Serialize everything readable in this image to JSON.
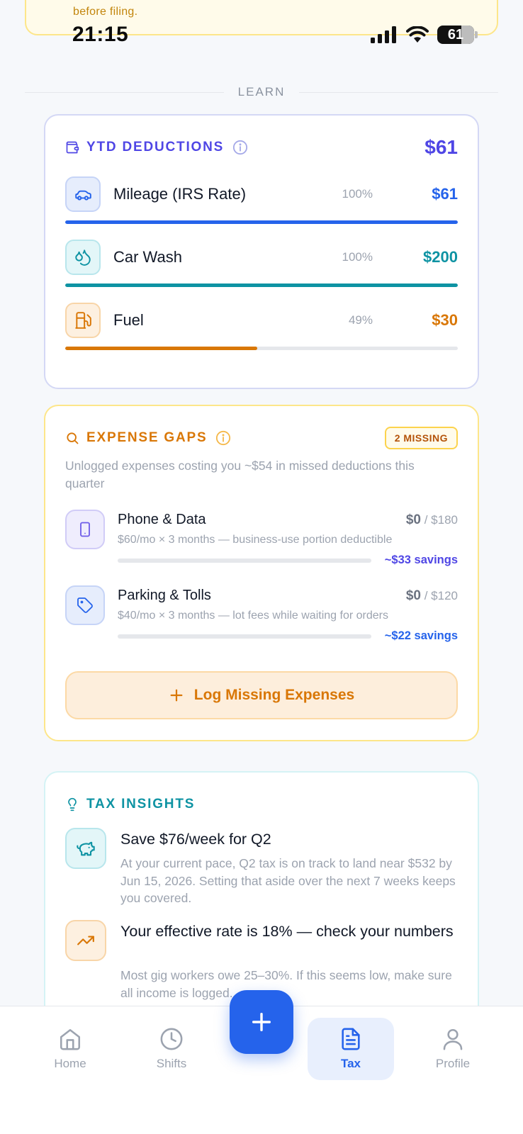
{
  "top_banner": {
    "text": "before filing."
  },
  "status_bar": {
    "time": "21:15",
    "battery": "61"
  },
  "section": {
    "label": "LEARN"
  },
  "ytd": {
    "title": "YTD DEDUCTIONS",
    "total": "$61",
    "items": [
      {
        "name": "Mileage (IRS Rate)",
        "percent": "100%",
        "amount": "$61",
        "fill": 1.0,
        "color": "#2563eb",
        "icon": "car-icon"
      },
      {
        "name": "Car Wash",
        "percent": "100%",
        "amount": "$200",
        "fill": 1.0,
        "color": "#0e93a3",
        "icon": "droplets-icon"
      },
      {
        "name": "Fuel",
        "percent": "49%",
        "amount": "$30",
        "fill": 0.49,
        "color": "#d97706",
        "icon": "fuel-icon"
      }
    ]
  },
  "gaps": {
    "title": "EXPENSE GAPS",
    "badge": "2 MISSING",
    "description": "Unlogged expenses costing you ~$54 in missed deductions this quarter",
    "items": [
      {
        "name": "Phone & Data",
        "logged": "$0",
        "target": "/ $180",
        "description": "$60/mo × 3 months — business-use portion deductible",
        "savings": "~$33 savings",
        "progress": 0,
        "icon": "smartphone-icon"
      },
      {
        "name": "Parking & Tolls",
        "logged": "$0",
        "target": "/ $120",
        "description": "$40/mo × 3 months — lot fees while waiting for orders",
        "savings": "~$22 savings",
        "progress": 0,
        "icon": "tag-icon"
      }
    ],
    "button_label": "Log Missing Expenses"
  },
  "tax_insights": {
    "title": "TAX INSIGHTS",
    "items": [
      {
        "title": "Save $76/week for Q2",
        "description": "At your current pace, Q2 tax is on track to land near $532 by Jun 15, 2026. Setting that aside over the next 7 weeks keeps you covered.",
        "icon": "piggy-bank-icon"
      },
      {
        "title": "Your effective rate is 18% — check your numbers",
        "description": "Most gig workers owe 25–30%. If this seems low, make sure all income is logged.",
        "icon": "trending-up-icon"
      }
    ]
  },
  "nav": {
    "items": [
      {
        "label": "Home",
        "icon": "home-icon"
      },
      {
        "label": "Shifts",
        "icon": "clock-icon"
      },
      {
        "label": "Tax",
        "icon": "file-text-icon",
        "active": true
      },
      {
        "label": "Profile",
        "icon": "user-icon"
      }
    ]
  },
  "colors": {
    "primary": "#2563eb",
    "indigo": "#4f46e5",
    "teal": "#0e93a3",
    "amber": "#d97706"
  }
}
